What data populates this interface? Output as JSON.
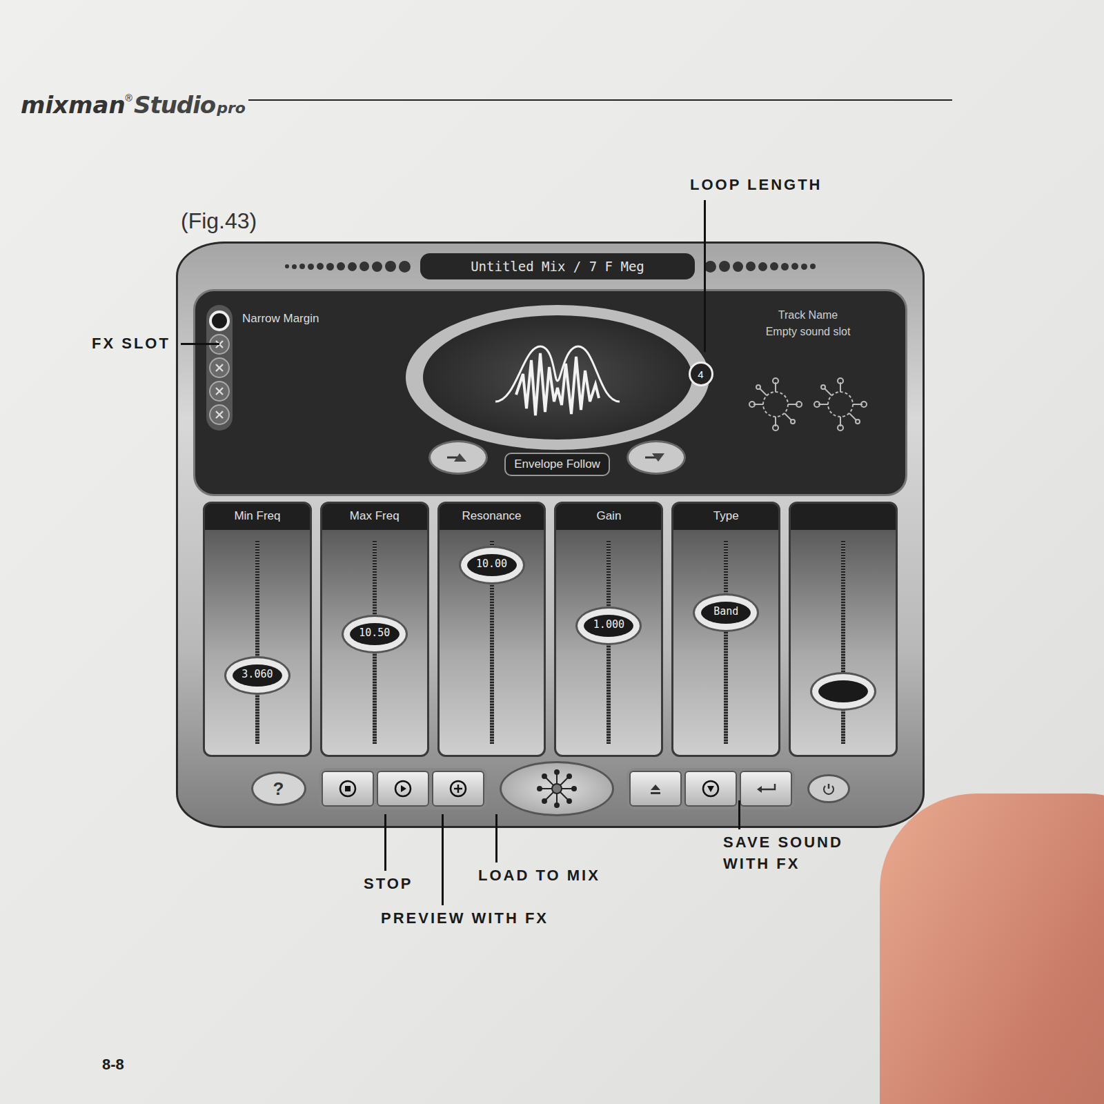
{
  "header": {
    "brand": "mixman",
    "mark": "®",
    "product": "Studio",
    "edition": "pro"
  },
  "figure": {
    "caption": "(Fig.43)"
  },
  "window": {
    "title": "Untitled Mix / 7 F Meg"
  },
  "fx_slots": {
    "active_name": "Narrow Margin",
    "slots": [
      {
        "selected": true
      },
      {
        "selected": false
      },
      {
        "selected": false
      },
      {
        "selected": false
      },
      {
        "selected": false
      }
    ]
  },
  "loop_length": {
    "value": "4"
  },
  "track": {
    "label": "Track Name",
    "value": "Empty sound slot"
  },
  "envelope": {
    "label": "Envelope Follow"
  },
  "sliders": [
    {
      "label": "Min Freq",
      "reading": "3.060",
      "level": 0.3
    },
    {
      "label": "Max Freq",
      "reading": "10.50",
      "level": 0.55
    },
    {
      "label": "Resonance",
      "reading": "10.00",
      "level": 0.97
    },
    {
      "label": "Gain",
      "reading": "1.000",
      "level": 0.6
    },
    {
      "label": "Type",
      "reading": "Band",
      "level": 0.68
    },
    {
      "label": "",
      "reading": "",
      "level": 0.2
    }
  ],
  "help": {
    "label": "?"
  },
  "callouts": {
    "fx_slot": "FX SLOT",
    "loop_length": "LOOP LENGTH",
    "stop": "STOP",
    "preview": "PREVIEW WITH FX",
    "load": "LOAD TO MIX",
    "save": "SAVE SOUND WITH FX"
  },
  "page_number": "8-8"
}
